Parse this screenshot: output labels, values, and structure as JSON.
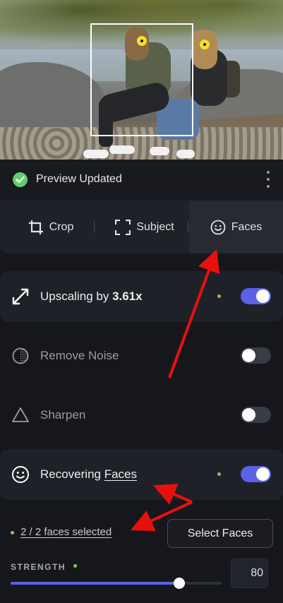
{
  "header": {
    "status_text": "Preview Updated"
  },
  "tabs": [
    {
      "label": "Crop"
    },
    {
      "label": "Subject"
    },
    {
      "label": "Faces"
    }
  ],
  "upscaling": {
    "prefix": "Upscaling by ",
    "value": "3.61x",
    "enabled": true
  },
  "remove_noise": {
    "label": "Remove Noise",
    "enabled": false
  },
  "sharpen": {
    "label": "Sharpen",
    "enabled": false
  },
  "recovering": {
    "prefix": "Recovering ",
    "link": "Faces",
    "enabled": true
  },
  "faces": {
    "selected_count": "2",
    "selected_suffix": " / 2 faces selected",
    "select_button": "Select Faces",
    "strength_label": "STRENGTH",
    "strength_value": "80",
    "strength_fraction": 0.8
  },
  "colors": {
    "accent": "#5b62e6",
    "status_green": "#5fcf6a",
    "face_marker": "#f5e02a",
    "annotation": "#e8100f"
  }
}
